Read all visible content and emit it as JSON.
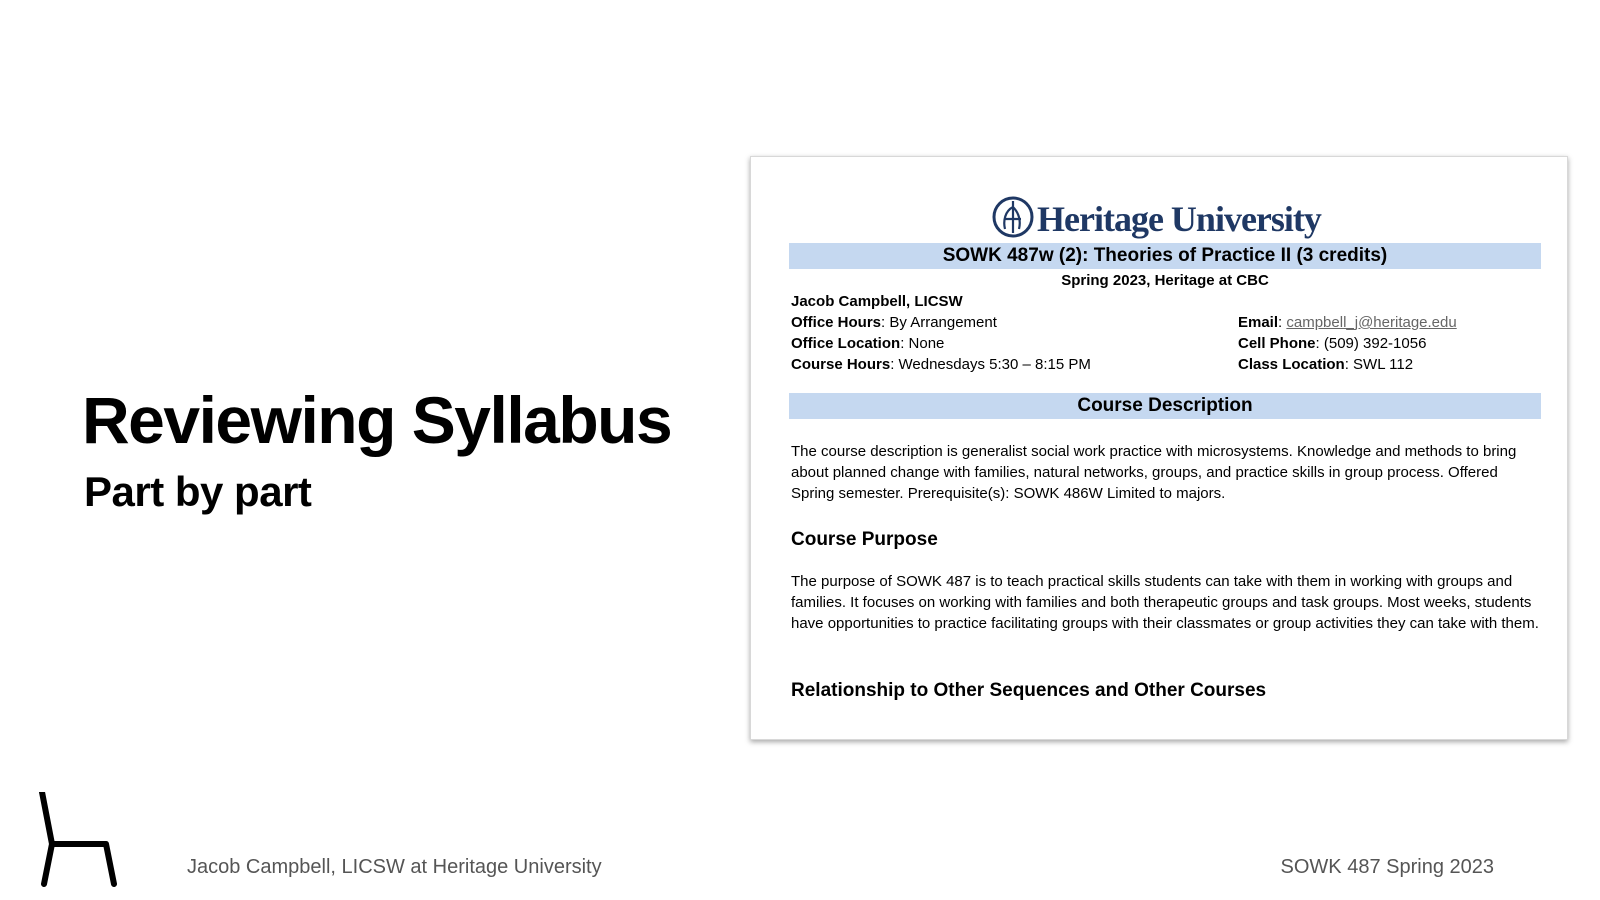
{
  "slide": {
    "title": "Reviewing Syllabus",
    "subtitle": "Part by part",
    "footer_left": "Jacob Campbell, LICSW at Heritage University",
    "footer_right": "SOWK 487 Spring 2023"
  },
  "document": {
    "logo_text": "Heritage University",
    "course_title": "SOWK 487w (2): Theories of Practice II (3 credits)",
    "term": "Spring 2023, Heritage at CBC",
    "instructor": "Jacob Campbell, LICSW",
    "office_hours_label": "Office Hours",
    "office_hours_value": ": By Arrangement",
    "office_location_label": "Office Location",
    "office_location_value": ": None",
    "course_hours_label": "Course Hours",
    "course_hours_value": ": Wednesdays 5:30 – 8:15 PM",
    "email_label": "Email",
    "email_sep": ": ",
    "email_value": "campbell_j@heritage.edu",
    "cell_label": "Cell Phone",
    "cell_value": ": (509) 392-1056",
    "class_location_label": "Class Location",
    "class_location_value": ": SWL 112",
    "description_heading": "Course Description",
    "description_text": "The course description is generalist social work practice with microsystems. Knowledge and methods to bring about planned change with families, natural networks, groups, and practice skills in group process. Offered Spring semester. Prerequisite(s): SOWK 486W Limited to majors.",
    "purpose_heading": "Course Purpose",
    "purpose_text": "The purpose of SOWK 487 is to teach practical skills students can take with them in working with groups and families. It focuses on working with families and both therapeutic groups and task groups. Most weeks, students have opportunities to practice facilitating groups with their classmates or group activities they can take with them.",
    "relationship_heading": "Relationship to Other Sequences and Other Courses"
  },
  "colors": {
    "band": "#c5d8f0",
    "logo": "#1f3864",
    "footer_text": "#555555"
  },
  "icons": {
    "chair": "chair-icon",
    "logo_mark": "heritage-logo-icon"
  }
}
